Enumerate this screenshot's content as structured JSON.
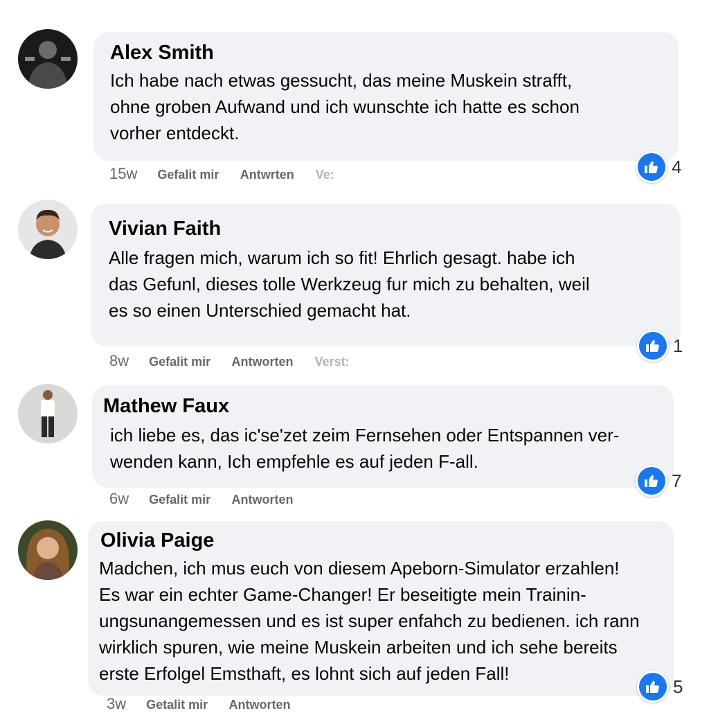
{
  "colors": {
    "bubble": "#f0f2f5",
    "like_blue": "#1877f2",
    "meta_gray": "#65676b"
  },
  "comments": [
    {
      "author": "Alex Smith",
      "lines": [
        "Ich habe nach  etwas  gessucht, das meine Muskein strafft,",
        "ohne groben Aufwand und ich wunschte ich hatte es schon",
        "vorher entdeckt."
      ],
      "time": "15w",
      "like_label": "Gefalit mir",
      "reply_label": "Antwrten",
      "extra_label": "Ve:",
      "reactions": "4",
      "icon": "thumbs-up-icon"
    },
    {
      "author": "Vivian Faith",
      "lines": [
        "Alle fragen  mich, warum  ich so fit! Ehrlich gesagt.  habe ich",
        "das Gefunl, dieses tolle Werkzeug fur mich zu behalten, weil",
        "es so einen Unterschied gemacht hat."
      ],
      "time": "8w",
      "like_label": "Gefalit mir",
      "reply_label": "Antworten",
      "extra_label": "Verst:",
      "reactions": "1",
      "icon": "thumbs-up-icon"
    },
    {
      "author": "Mathew Faux",
      "lines": [
        "ich liebe es, das ic'se'zet zeim Fernsehen oder Entspannen ver-",
        "wenden kann, Ich empfehle es auf jeden F-all."
      ],
      "time": "6w",
      "like_label": "Gefalit mir",
      "reply_label": "Antworten",
      "reactions": "7",
      "icon": "thumbs-up-icon"
    },
    {
      "author": "Olivia Paige",
      "lines": [
        "Madchen, ich mus euch  von diesem Apeborn-Simulator erzahlen!",
        "Es war  ein  echter  Game-Changer!  Er  beseitigte  mein  Trainin-",
        "ungsunangemessen und es ist super enfahch zu bedienen. ich rann",
        "wirklich spuren, wie meine Muskein arbeiten und ich sehe bereits",
        "erste Erfolgel Emsthaft, es lohnt sich auf jeden Fall!"
      ],
      "time": "3w",
      "like_label": "Getalit mir",
      "reply_label": "Antworten",
      "reactions": "5",
      "icon": "thumbs-up-icon"
    }
  ]
}
